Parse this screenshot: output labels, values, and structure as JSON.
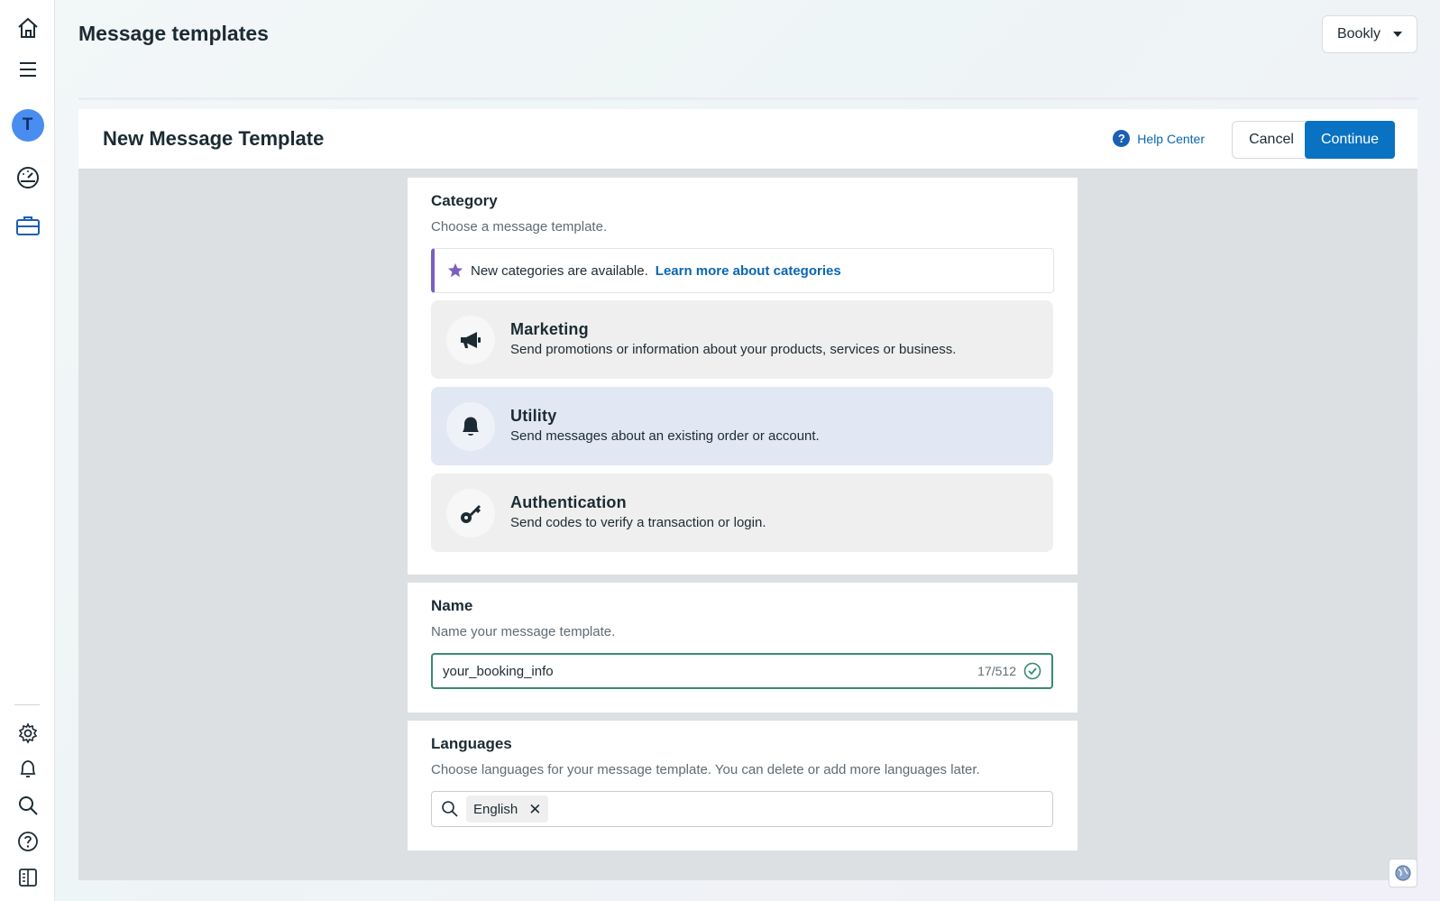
{
  "page": {
    "title": "Message templates",
    "account": "Bookly"
  },
  "rail": {
    "avatar_initial": "T",
    "top_icons": [
      "home-icon",
      "menu-icon",
      "dashboard-icon",
      "briefcase-icon"
    ],
    "bottom_icons": [
      "gear-icon",
      "bell-icon",
      "search-icon",
      "help-icon",
      "panel-icon"
    ]
  },
  "panel": {
    "title": "New Message Template",
    "help_label": "Help Center",
    "cancel_label": "Cancel",
    "continue_label": "Continue"
  },
  "category": {
    "title": "Category",
    "subtitle": "Choose a message template.",
    "notice_text": "New categories are available.",
    "notice_link": "Learn more about categories",
    "options": [
      {
        "title": "Marketing",
        "desc": "Send promotions or information about your products, services or business.",
        "icon": "megaphone-icon"
      },
      {
        "title": "Utility",
        "desc": "Send messages about an existing order or account.",
        "icon": "bell-icon"
      },
      {
        "title": "Authentication",
        "desc": "Send codes to verify a transaction or login.",
        "icon": "key-icon"
      }
    ],
    "selected": "Utility"
  },
  "name": {
    "title": "Name",
    "subtitle": "Name your message template.",
    "value": "your_booking_info",
    "counter": "17/512"
  },
  "languages": {
    "title": "Languages",
    "subtitle": "Choose languages for your message template. You can delete or add more languages later.",
    "chips": [
      "English"
    ]
  },
  "colors": {
    "accent": "#0a72c2",
    "link": "#0a66b0",
    "notice_bar": "#7b5fc0",
    "valid": "#3a8a6e",
    "selected_option": "#e1e8f4"
  }
}
